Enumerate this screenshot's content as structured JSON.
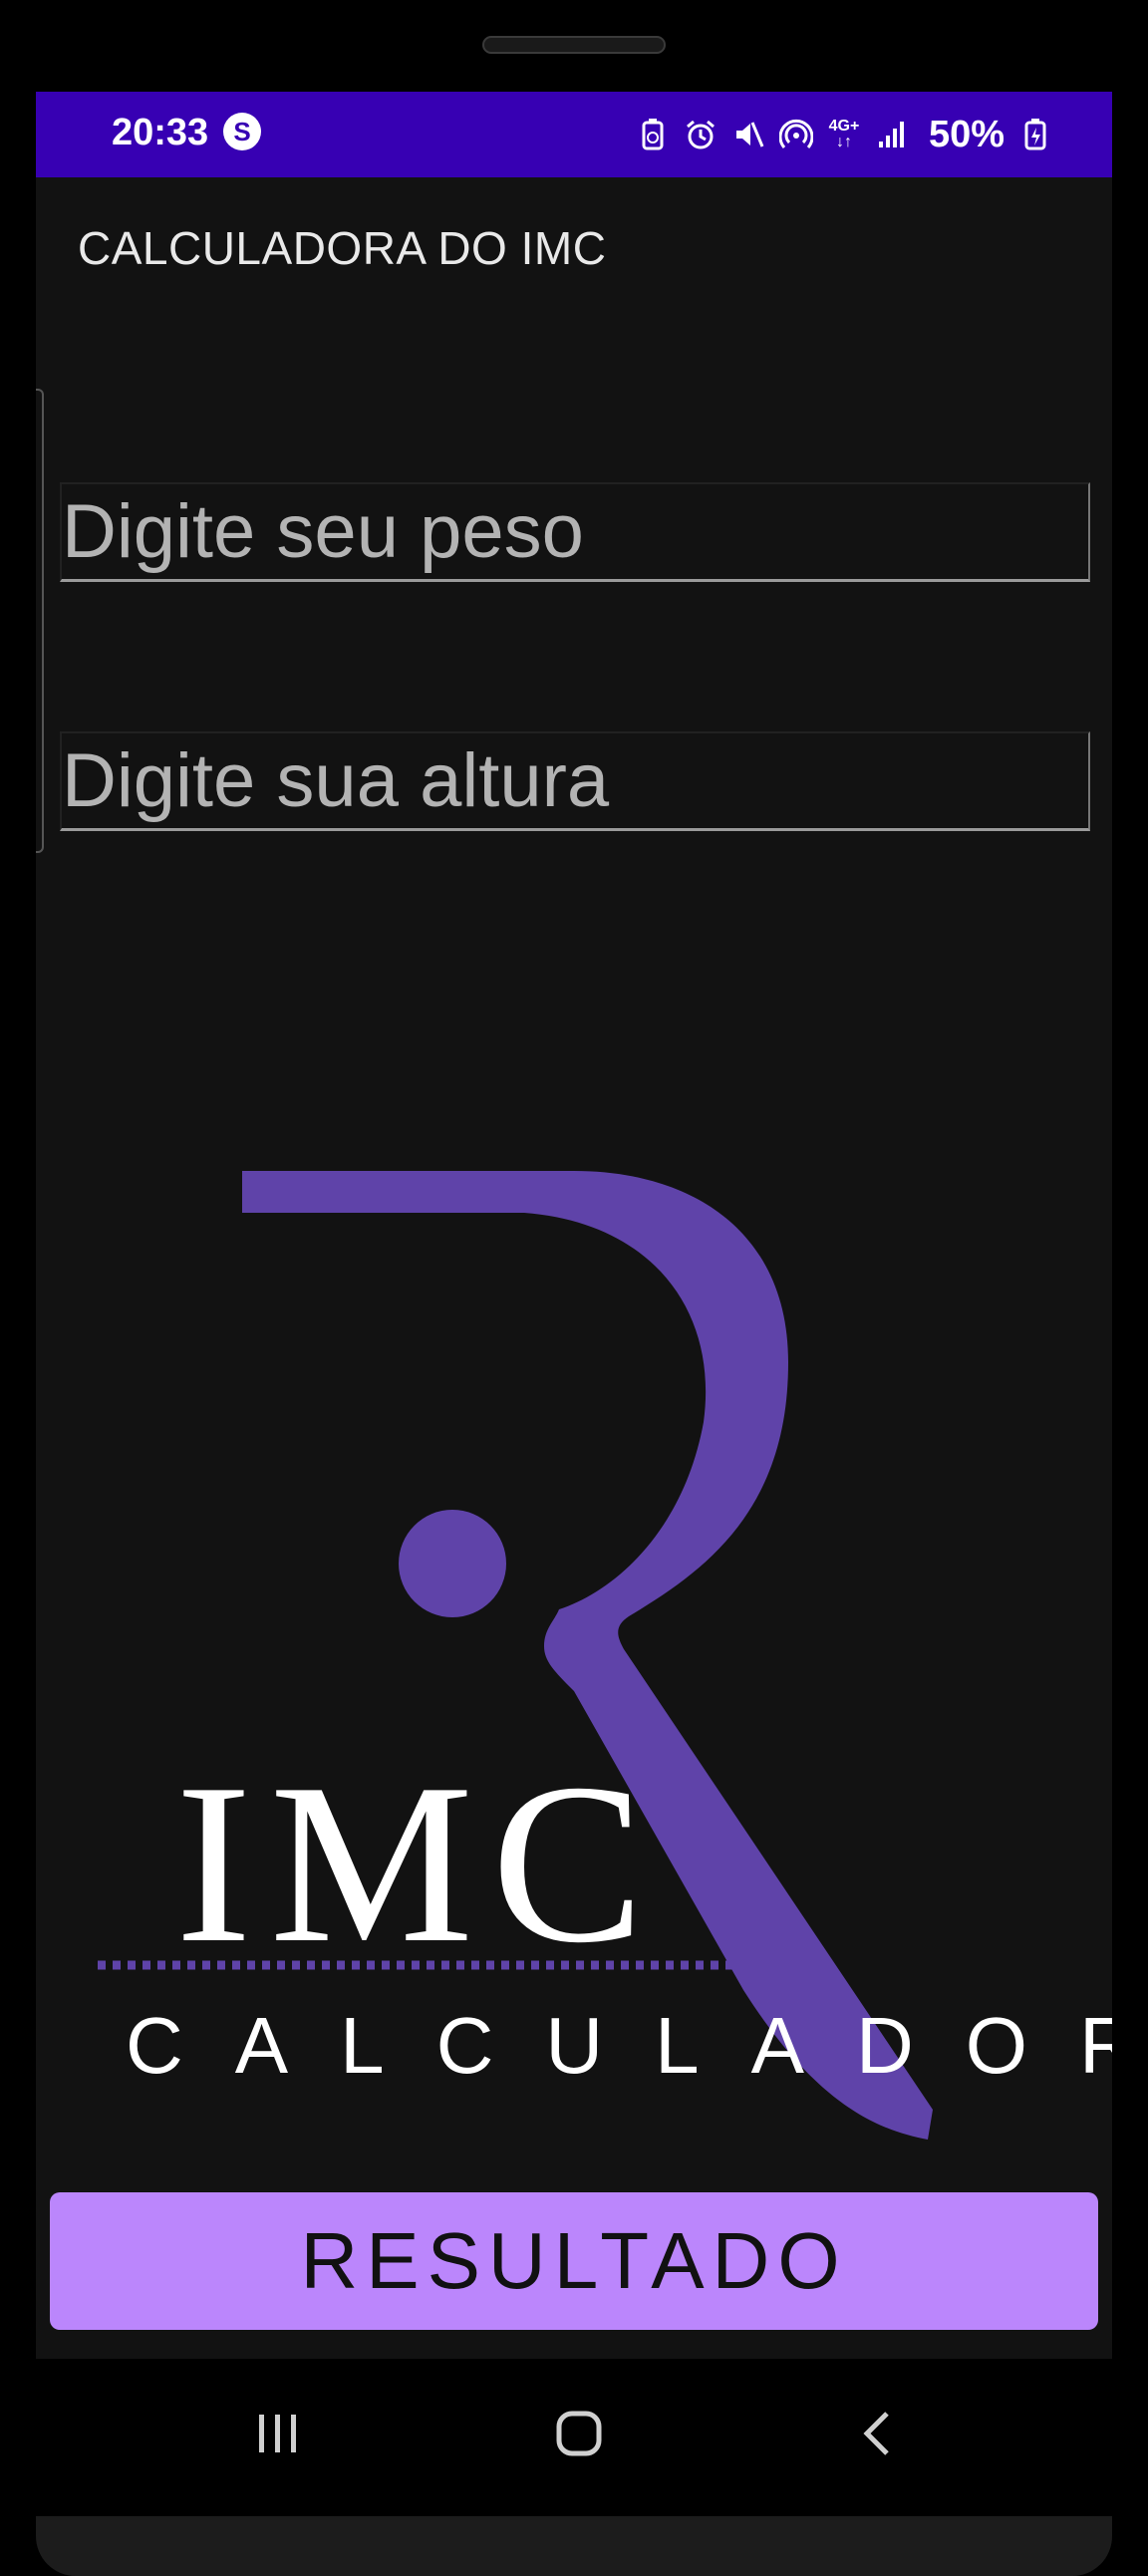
{
  "status_bar": {
    "time": "20:33",
    "battery_percent": "50%",
    "network_label": "4G+",
    "color": "#3700b3",
    "icons": [
      "s-app-icon",
      "battery-saver-icon",
      "alarm-icon",
      "mute-icon",
      "hotspot-icon",
      "network-4g-icon",
      "signal-icon",
      "battery-charging-icon"
    ]
  },
  "app_bar": {
    "title": "CALCULADORA DO IMC"
  },
  "form": {
    "weight_placeholder": "Digite seu peso",
    "height_placeholder": "Digite sua altura"
  },
  "logo": {
    "word": "IMC",
    "subtitle": "CALCULADORA",
    "accent_color": "#5f43a9"
  },
  "result_button": {
    "label": "RESULTADO",
    "color": "#bb86fc"
  },
  "nav_bar": {
    "icons": [
      "recent-apps-icon",
      "home-icon",
      "back-icon"
    ]
  }
}
